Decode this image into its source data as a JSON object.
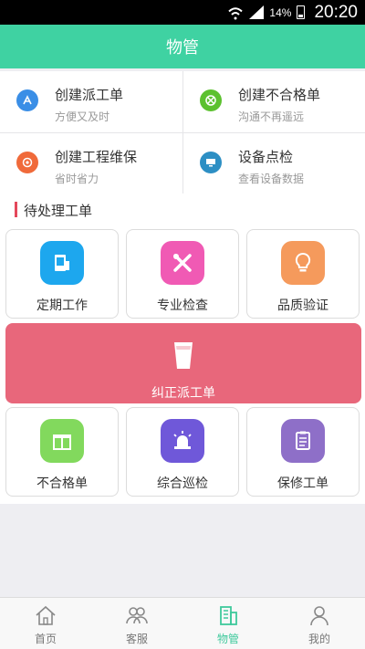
{
  "status_bar": {
    "battery": "14%",
    "time": "20:20"
  },
  "header": {
    "title": "物管"
  },
  "quick_actions": [
    {
      "title": "创建派工单",
      "subtitle": "方便又及时",
      "icon": "app-store-icon",
      "color": "#3a8ee6"
    },
    {
      "title": "创建不合格单",
      "subtitle": "沟通不再遥远",
      "icon": "xbox-icon",
      "color": "#5cc12f"
    },
    {
      "title": "创建工程维保",
      "subtitle": "省时省力",
      "icon": "target-icon",
      "color": "#f06a3a"
    },
    {
      "title": "设备点检",
      "subtitle": "查看设备数据",
      "icon": "monitor-icon",
      "color": "#2d8fc4"
    }
  ],
  "section": {
    "title": "待处理工单"
  },
  "work_cards_top": [
    {
      "label": "定期工作",
      "icon": "phone-doc-icon",
      "color": "#1da7ee"
    },
    {
      "label": "专业检查",
      "icon": "tools-icon",
      "color": "#f05ab4"
    },
    {
      "label": "品质验证",
      "icon": "bulb-icon",
      "color": "#f59a5c"
    }
  ],
  "banner": {
    "label": "纠正派工单",
    "icon": "cup-icon",
    "color": "#e8677b"
  },
  "work_cards_bottom": [
    {
      "label": "不合格单",
      "icon": "gift-icon",
      "color": "#82d95d"
    },
    {
      "label": "综合巡检",
      "icon": "alarm-icon",
      "color": "#6f58d9"
    },
    {
      "label": "保修工单",
      "icon": "clipboard-icon",
      "color": "#8e6fc8"
    }
  ],
  "bottom_nav": [
    {
      "label": "首页",
      "icon": "home-icon"
    },
    {
      "label": "客服",
      "icon": "users-icon"
    },
    {
      "label": "物管",
      "icon": "building-icon",
      "active": true
    },
    {
      "label": "我的",
      "icon": "user-icon"
    }
  ],
  "colors": {
    "brand": "#3fd2a2",
    "accent_red": "#e4475b",
    "active_nav": "#3fc99c"
  }
}
